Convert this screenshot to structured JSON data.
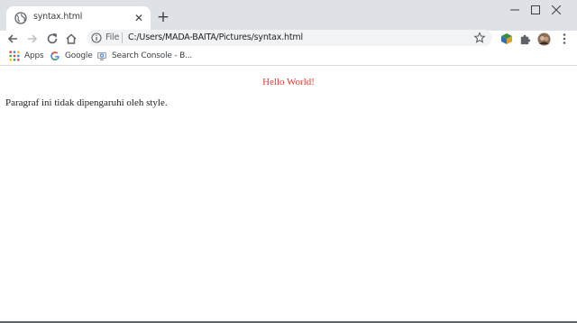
{
  "tab": {
    "title": "syntax.html",
    "close_glyph": "✕",
    "favicon": "globe-icon"
  },
  "new_tab_glyph": "+",
  "window_controls": [
    "minimize-icon",
    "maximize-icon",
    "close-icon"
  ],
  "toolbar": {
    "icons": [
      "back-arrow-icon",
      "forward-arrow-icon",
      "reload-icon",
      "home-icon"
    ]
  },
  "omnibox": {
    "scheme_chip": "File",
    "url": "C:/Users/MADA-BAITA/Pictures/syntax.html"
  },
  "extensions": [
    "extension-cube-icon",
    "puzzle-icon",
    "profile-avatar"
  ],
  "bookmarks": [
    {
      "label": "Apps",
      "icon": "apps-grid-icon"
    },
    {
      "label": "Google",
      "icon": "google-g-icon"
    },
    {
      "label": "Search Console - B...",
      "icon": "search-console-icon"
    }
  ],
  "page": {
    "heading": "Hello World!",
    "paragraph": "Paragraf ini tidak dipengaruhi oleh style.",
    "heading_color": "#e53935"
  }
}
